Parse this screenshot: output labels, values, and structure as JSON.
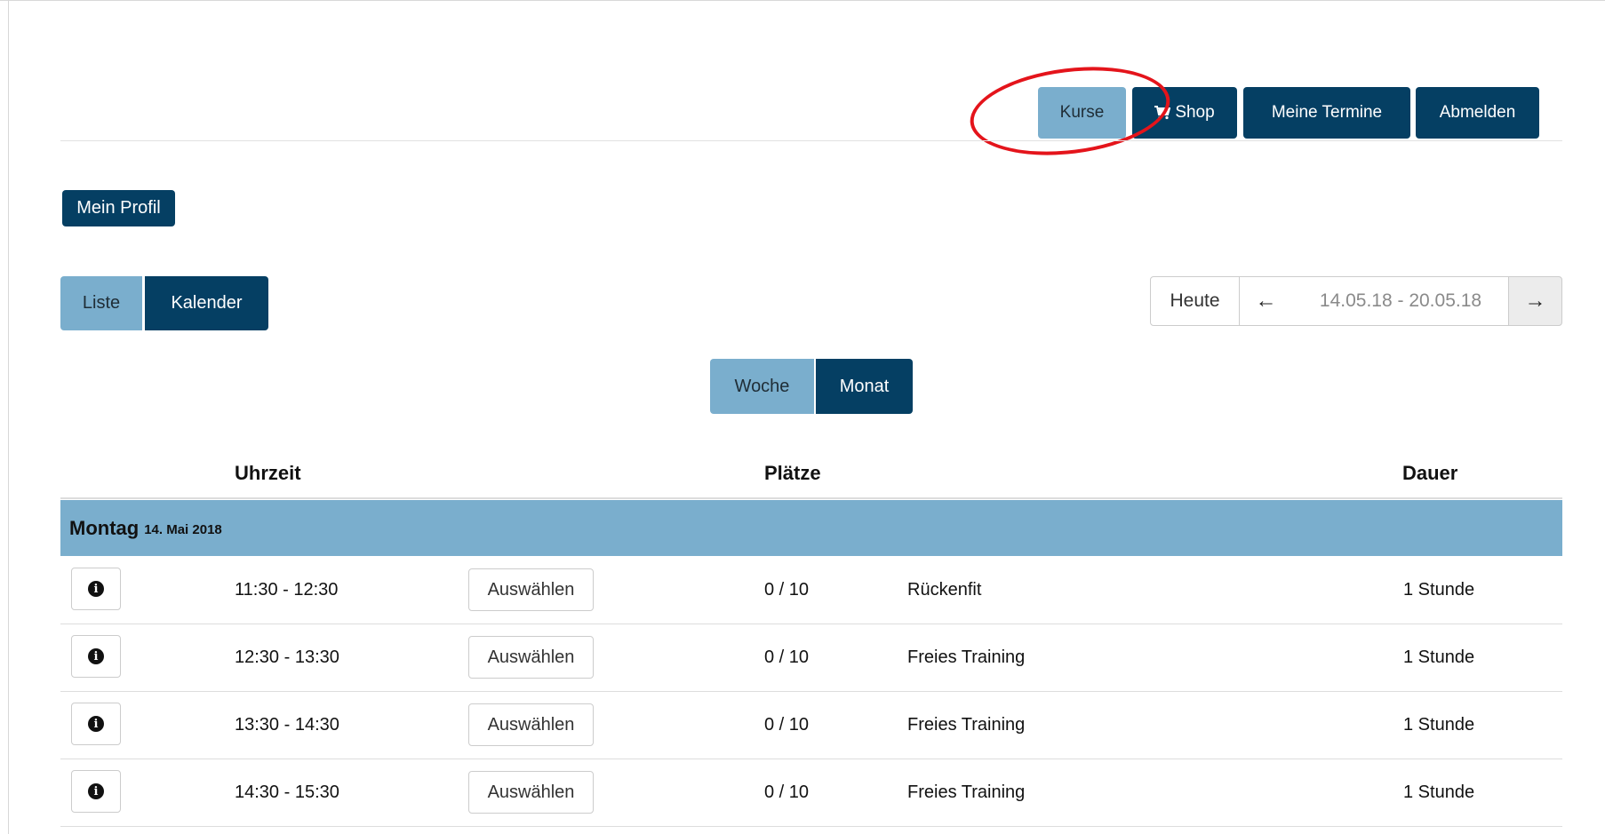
{
  "nav": {
    "courses_label": "Kurse",
    "shop_label": "Shop",
    "appointments_label": "Meine Termine",
    "logout_label": "Abmelden",
    "shop_icon": "shopping-cart-icon"
  },
  "profile_label": "Mein Profil",
  "view_toggle": {
    "list_label": "Liste",
    "calendar_label": "Kalender"
  },
  "range_toggle": {
    "week_label": "Woche",
    "month_label": "Monat"
  },
  "date_nav": {
    "today_label": "Heute",
    "prev_icon": "←",
    "range": "14.05.18 - 20.05.18",
    "next_icon": "→"
  },
  "table": {
    "headers": {
      "time": "Uhrzeit",
      "places": "Plätze",
      "duration": "Dauer"
    },
    "day": {
      "name": "Montag",
      "date": "14. Mai 2018"
    },
    "select_label": "Auswählen",
    "info_glyph": "i",
    "rows": [
      {
        "time": "11:30 - 12:30",
        "places": "0 / 10",
        "course": "Rückenfit",
        "duration": "1 Stunde"
      },
      {
        "time": "12:30 - 13:30",
        "places": "0 / 10",
        "course": "Freies Training",
        "duration": "1 Stunde"
      },
      {
        "time": "13:30 - 14:30",
        "places": "0 / 10",
        "course": "Freies Training",
        "duration": "1 Stunde"
      },
      {
        "time": "14:30 - 15:30",
        "places": "0 / 10",
        "course": "Freies Training",
        "duration": "1 Stunde"
      }
    ]
  },
  "colors": {
    "dark": "#053f63",
    "light": "#7aaecd",
    "highlight": "#e4141b"
  }
}
